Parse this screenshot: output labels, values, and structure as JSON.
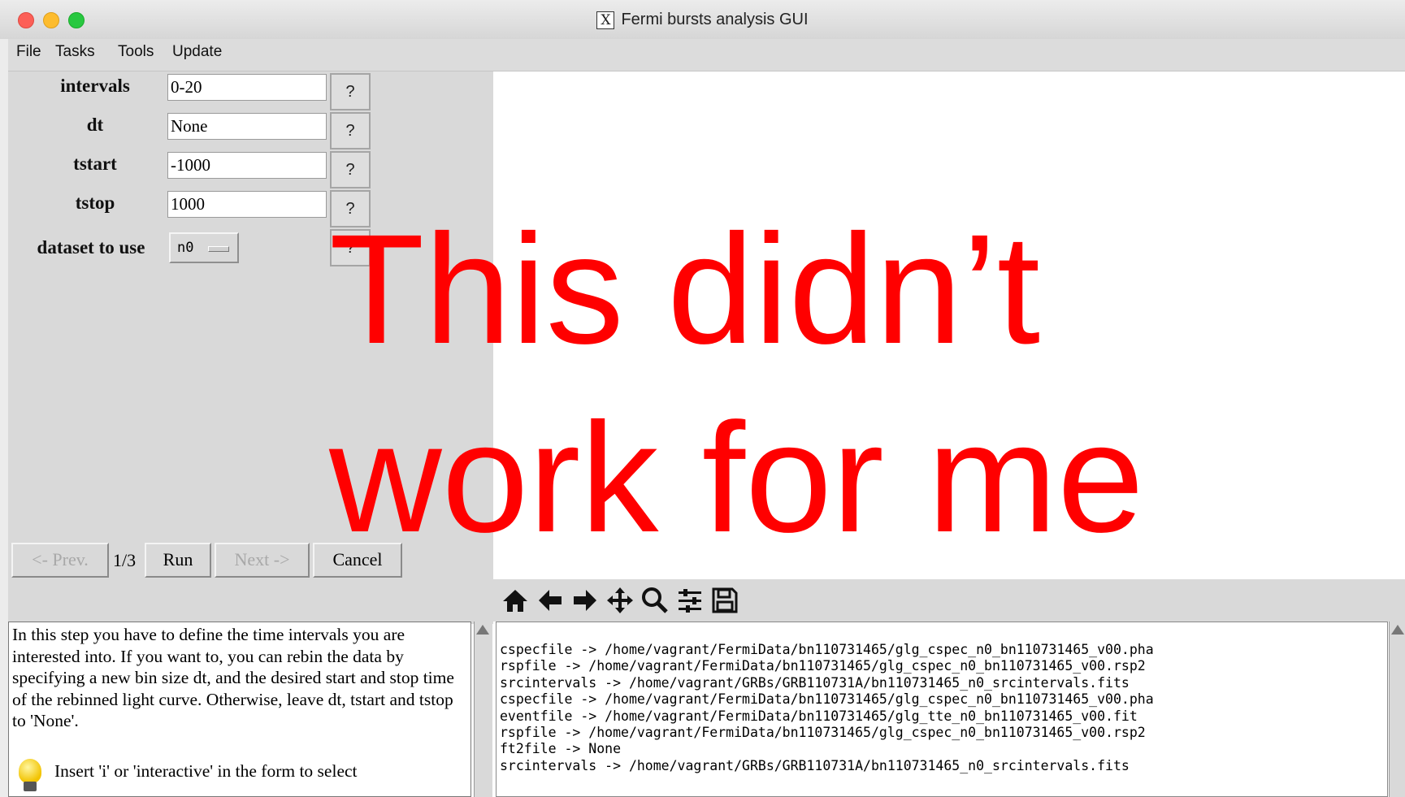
{
  "window": {
    "title": "Fermi bursts analysis GUI",
    "x_logo": "X"
  },
  "menu": [
    "File",
    "Tasks",
    "Tools",
    "Update"
  ],
  "form": {
    "fields": [
      {
        "label": "intervals",
        "value": "0-20"
      },
      {
        "label": "dt",
        "value": "None"
      },
      {
        "label": "tstart",
        "value": "-1000"
      },
      {
        "label": "tstop",
        "value": "1000"
      }
    ],
    "dataset_label": "dataset to use",
    "dataset_value": "n0",
    "help_label": "?"
  },
  "nav": {
    "prev": "<- Prev.",
    "page": "1/3",
    "run": "Run",
    "next": "Next ->",
    "cancel": "Cancel"
  },
  "toolbar_icons": [
    "home-icon",
    "back-arrow-icon",
    "forward-arrow-icon",
    "pan-icon",
    "zoom-icon",
    "subplots-icon",
    "save-icon"
  ],
  "help_text": "In this step you have to define the time intervals you are interested into. If you want to, you can rebin the data by specifying a new bin size dt, and the desired start and stop time of the rebinned light curve. Otherwise, leave dt, tstart and tstop to 'None'.",
  "tip_text": "Insert 'i' or 'interactive' in the form to select",
  "log_lines": [
    "cspecfile -> /home/vagrant/FermiData/bn110731465/glg_cspec_n0_bn110731465_v00.pha",
    "rspfile -> /home/vagrant/FermiData/bn110731465/glg_cspec_n0_bn110731465_v00.rsp2",
    "srcintervals -> /home/vagrant/GRBs/GRB110731A/bn110731465_n0_srcintervals.fits",
    "cspecfile -> /home/vagrant/FermiData/bn110731465/glg_cspec_n0_bn110731465_v00.pha",
    "eventfile -> /home/vagrant/FermiData/bn110731465/glg_tte_n0_bn110731465_v00.fit",
    "rspfile -> /home/vagrant/FermiData/bn110731465/glg_cspec_n0_bn110731465_v00.rsp2",
    "ft2file -> None",
    "srcintervals -> /home/vagrant/GRBs/GRB110731A/bn110731465_n0_srcintervals.fits"
  ],
  "overlay": {
    "line1": "This didn’t",
    "line2": "work for me",
    "color": "#ff0000"
  }
}
